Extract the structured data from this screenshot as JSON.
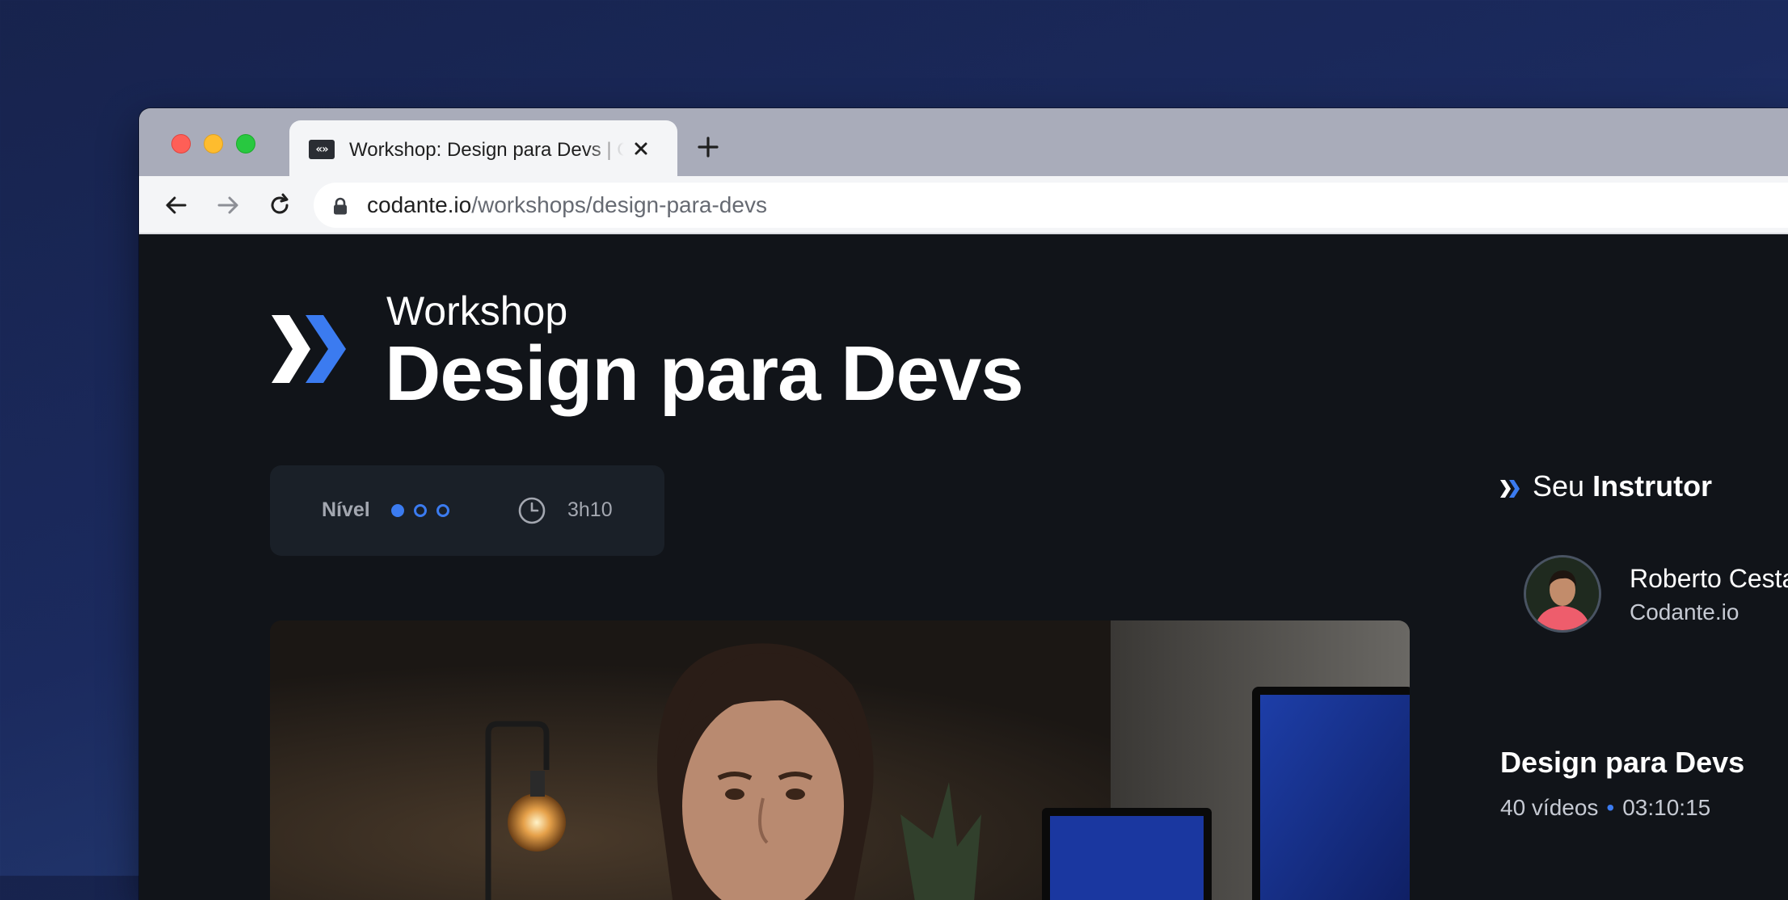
{
  "browser": {
    "tab": {
      "title": "Workshop: Design para Devs | Codante",
      "favicon": "codante-logo-icon"
    },
    "address": {
      "host": "codante.io",
      "path": "/workshops/design-para-devs"
    },
    "icons": [
      "back-arrow-icon",
      "forward-arrow-icon",
      "reload-icon",
      "lock-icon",
      "close-icon",
      "plus-icon"
    ]
  },
  "page": {
    "eyebrow": "Workshop",
    "title": "Design para Devs",
    "meta": {
      "level_label": "Nível",
      "level_filled": 1,
      "level_total": 3,
      "duration": "3h10"
    },
    "instructor": {
      "heading_prefix": "Seu",
      "heading_strong": "Instrutor",
      "name": "Roberto Cestari",
      "org": "Codante.io"
    },
    "course": {
      "title": "Design para Devs",
      "videos": "40 vídeos",
      "separator": "•",
      "total_time": "03:10:15"
    }
  },
  "colors": {
    "accent": "#3b7bf0",
    "page_bg": "#111419",
    "card_bg": "#1a2028"
  }
}
